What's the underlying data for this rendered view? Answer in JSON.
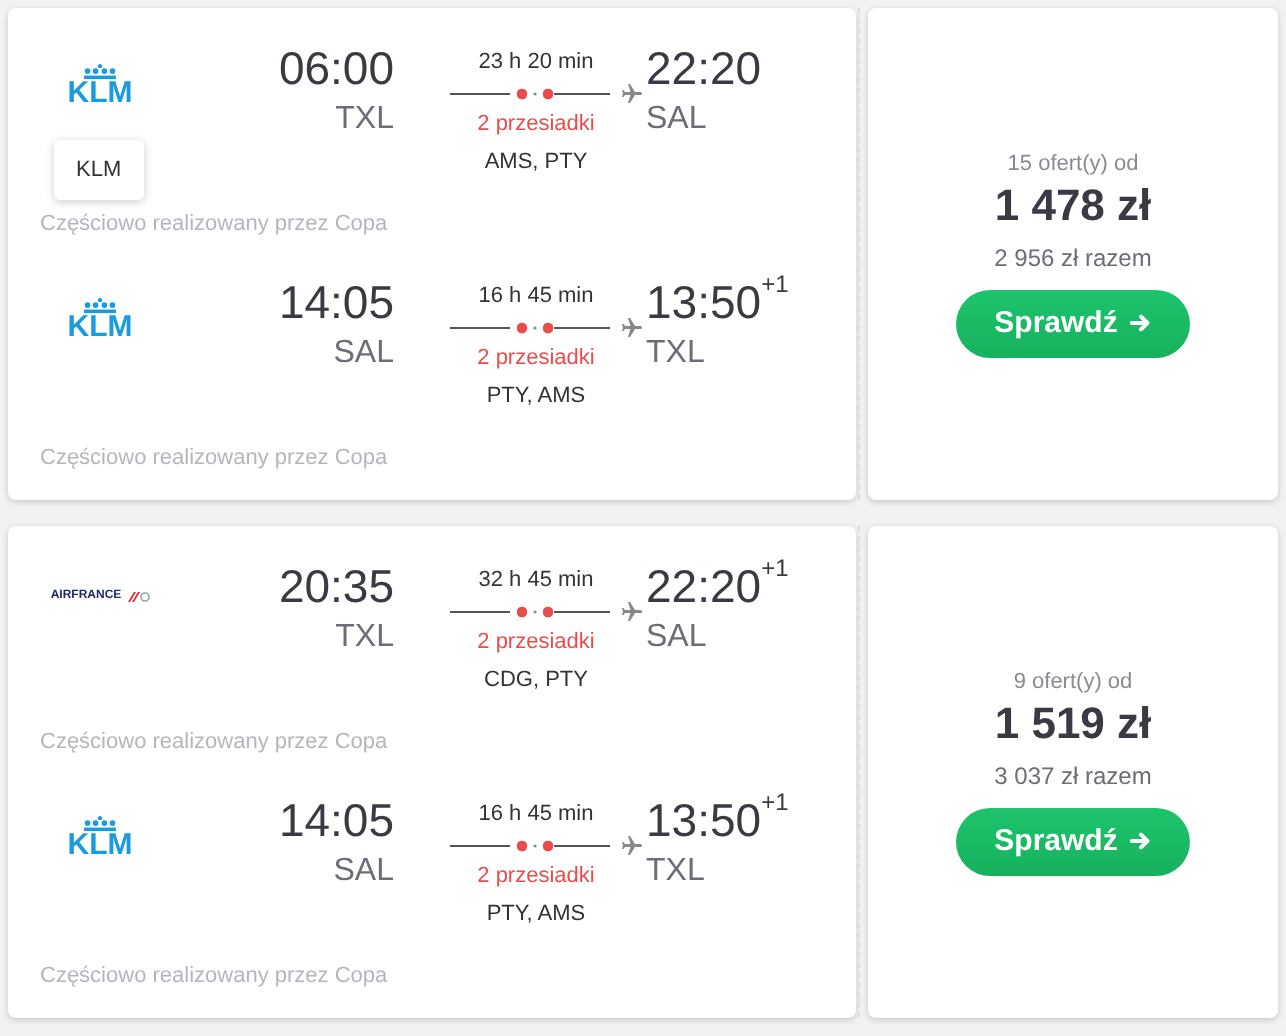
{
  "offers": [
    {
      "legs": [
        {
          "airline": {
            "kind": "klm",
            "logo_text": "KLM"
          },
          "tooltip": "KLM",
          "depart_time": "06:00",
          "depart_airport": "TXL",
          "duration": "23 h 20 min",
          "stops": "2 przesiadki",
          "via": "AMS, PTY",
          "arrive_time": "22:20",
          "arrive_airport": "SAL",
          "operated_by": "Częściowo realizowany przez Copa"
        },
        {
          "airline": {
            "kind": "klm",
            "logo_text": "KLM"
          },
          "depart_time": "14:05",
          "depart_airport": "SAL",
          "duration": "16 h 45 min",
          "stops": "2 przesiadki",
          "via": "PTY, AMS",
          "arrive_time": "13:50",
          "day_offset": "+1",
          "arrive_airport": "TXL",
          "operated_by": "Częściowo realizowany przez Copa"
        }
      ],
      "offers_count": "15 ofert(y) od",
      "price": "1 478 zł",
      "total": "2 956 zł razem",
      "button": "Sprawdź"
    },
    {
      "legs": [
        {
          "airline": {
            "kind": "airfrance",
            "logo_text": "AIRFRANCE"
          },
          "depart_time": "20:35",
          "depart_airport": "TXL",
          "duration": "32 h 45 min",
          "stops": "2 przesiadki",
          "via": "CDG, PTY",
          "arrive_time": "22:20",
          "day_offset": "+1",
          "arrive_airport": "SAL",
          "operated_by": "Częściowo realizowany przez Copa"
        },
        {
          "airline": {
            "kind": "klm",
            "logo_text": "KLM"
          },
          "depart_time": "14:05",
          "depart_airport": "SAL",
          "duration": "16 h 45 min",
          "stops": "2 przesiadki",
          "via": "PTY, AMS",
          "arrive_time": "13:50",
          "day_offset": "+1",
          "arrive_airport": "TXL",
          "operated_by": "Częściowo realizowany przez Copa"
        }
      ],
      "offers_count": "9 ofert(y) od",
      "price": "1 519 zł",
      "total": "3 037 zł razem",
      "button": "Sprawdź"
    }
  ]
}
